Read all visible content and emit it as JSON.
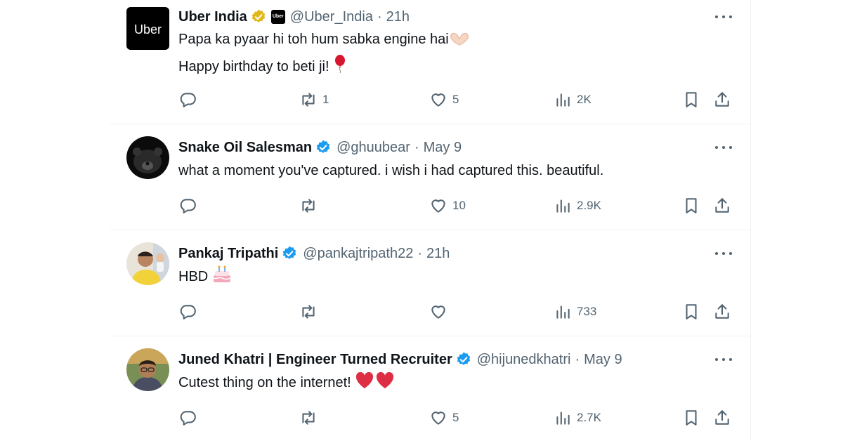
{
  "colors": {
    "text": "#0f1419",
    "secondary": "#536471",
    "verified_blue": "#1d9bf0",
    "verified_gold": "#e2b719",
    "heart_red": "#e0245e",
    "divider": "#eff3f4"
  },
  "tweets": [
    {
      "name": "Uber India",
      "handle": "@Uber_India",
      "time": "21h",
      "badge": "gold",
      "avatar": "uber-logo",
      "avatar_text": "Uber",
      "affiliate_text": "Uber",
      "lines": [
        "Papa ka pyaar hi toh hum sabka engine hai",
        "Happy birthday to beti ji! "
      ],
      "replies": "",
      "retweets": "1",
      "likes": "5",
      "views": "2K"
    },
    {
      "name": "Snake Oil Salesman",
      "handle": "@ghuubear",
      "time": "May 9",
      "badge": "blue",
      "avatar": "bear-photo",
      "lines": [
        "what a moment you've captured. i wish i had captured this. beautiful."
      ],
      "replies": "",
      "retweets": "",
      "likes": "10",
      "views": "2.9K"
    },
    {
      "name": "Pankaj Tripathi",
      "handle": "@pankajtripath22",
      "time": "21h",
      "badge": "blue",
      "avatar": "person-photo",
      "lines": [
        "HBD "
      ],
      "replies": "",
      "retweets": "",
      "likes": "",
      "views": "733"
    },
    {
      "name": "Juned Khatri | Engineer Turned Recruiter",
      "handle": "@hijunedkhatri",
      "time": "May 9",
      "badge": "blue",
      "avatar": "person-photo",
      "lines": [
        "Cutest thing on the internet! "
      ],
      "replies": "",
      "retweets": "",
      "likes": "5",
      "views": "2.7K"
    }
  ],
  "icons": {
    "reply": "reply-icon",
    "retweet": "retweet-icon",
    "like": "heart-icon",
    "views": "views-icon",
    "bookmark": "bookmark-icon",
    "share": "share-icon",
    "more": "more-icon"
  }
}
